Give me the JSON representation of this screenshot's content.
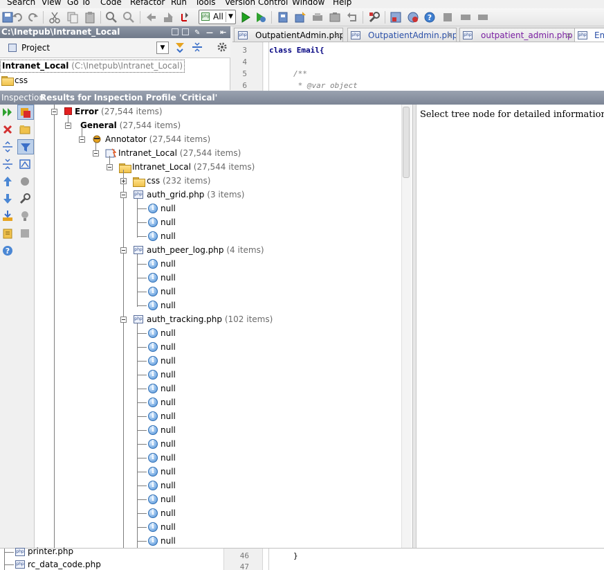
{
  "menu": [
    "Search",
    "View",
    "Go To",
    "Code",
    "Refactor",
    "Run",
    "Tools",
    "Version Control",
    "Window",
    "Help"
  ],
  "toolbar": {
    "run_config": "All"
  },
  "project": {
    "path_title": "C:\\Inetpub\\Intranet_Local",
    "view_label": "Project",
    "root_name": "Intranet_Local",
    "root_path": "(C:\\Inetpub\\Intranet_Local)",
    "first_child": "css"
  },
  "editor": {
    "tabs": [
      "OutpatientAdmin.php",
      "OutpatientAdmin.php",
      "outpatient_admin.php",
      "Em"
    ],
    "lines": [
      {
        "num": "3",
        "text": "class Email{"
      },
      {
        "num": "4",
        "text": ""
      },
      {
        "num": "5",
        "text": "/**"
      },
      {
        "num": "6",
        "text": " * @var object"
      }
    ],
    "bottom_lines": [
      {
        "num": "46",
        "text": "}"
      },
      {
        "num": "47",
        "text": ""
      }
    ]
  },
  "inspection": {
    "tab_label": "Inspection",
    "title": "Results for Inspection Profile 'Critical'",
    "detail_text": "Select tree node for detailed information",
    "tree": {
      "error": {
        "label": "Error",
        "count": "(27,544 items)"
      },
      "general": {
        "label": "General",
        "count": "(27,544 items)"
      },
      "annotator": {
        "label": "Annotator",
        "count": "(27,544 items)"
      },
      "module": {
        "label": "Intranet_Local",
        "count": "(27,544 items)"
      },
      "dir": {
        "label": "Intranet_Local",
        "count": "(27,544 items)"
      },
      "css": {
        "label": "css",
        "count": "(232 items)"
      },
      "files": [
        {
          "label": "auth_grid.php",
          "count": "(3 items)",
          "children": [
            "null",
            "null",
            "null"
          ]
        },
        {
          "label": "auth_peer_log.php",
          "count": "(4 items)",
          "children": [
            "null",
            "null",
            "null",
            "null"
          ]
        },
        {
          "label": "auth_tracking.php",
          "count": "(102 items)",
          "children": [
            "null",
            "null",
            "null",
            "null",
            "null",
            "null",
            "null",
            "null",
            "null",
            "null",
            "null",
            "null",
            "null",
            "null",
            "null",
            "null"
          ]
        }
      ]
    }
  },
  "bottom_files": [
    "printer.php",
    "rc_data_code.php"
  ]
}
